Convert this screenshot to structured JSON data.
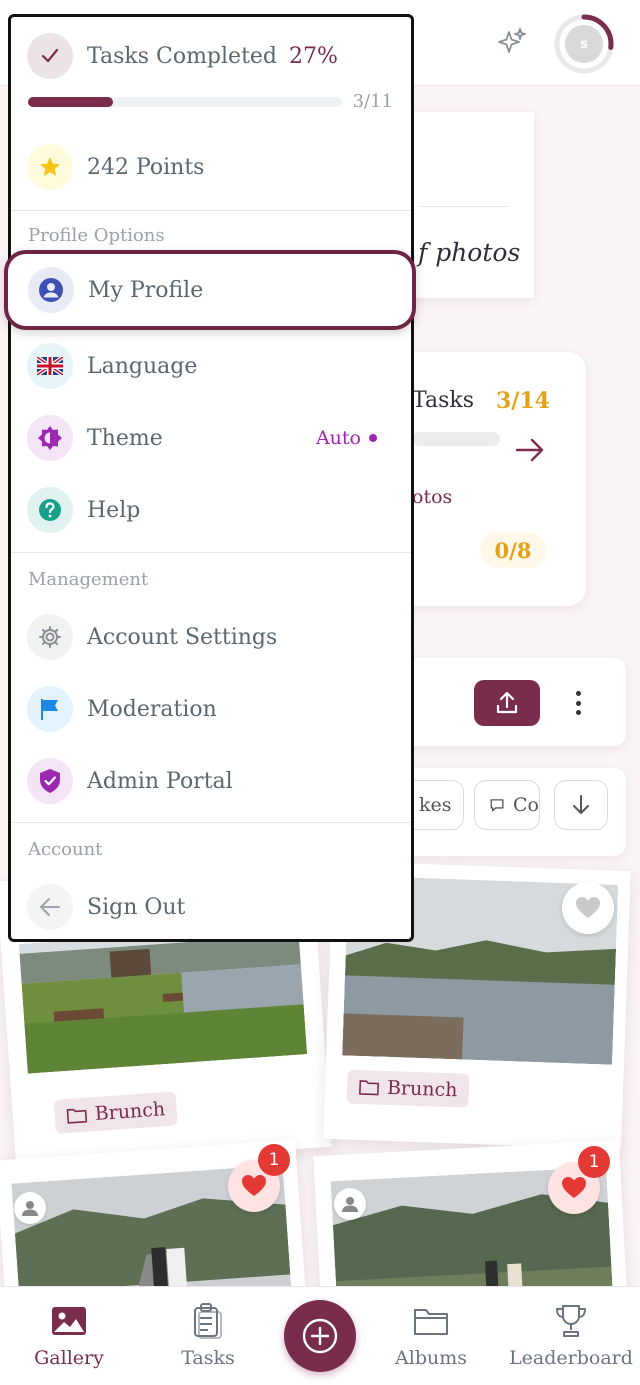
{
  "header": {
    "avatar_initial": "s",
    "icons": {
      "sparkle": "sparkle-icon"
    }
  },
  "colors": {
    "primary": "#7a2c4d",
    "gold": "#e3a21a",
    "purple": "#9c27b0",
    "danger": "#e53935"
  },
  "background": {
    "description_text": "f photos",
    "tasks_label": "Tasks",
    "tasks_count": "3/14",
    "photos_label": "otos",
    "photos_count": "0/8",
    "filters": {
      "likes": "kes",
      "comments": "Co"
    }
  },
  "menu": {
    "tasks_completed_label": "Tasks Completed",
    "tasks_completed_pct": "27%",
    "tasks_progress_fraction": 0.27,
    "tasks_count": "3/11",
    "points": "242 Points",
    "sections": {
      "profile": "Profile Options",
      "management": "Management",
      "account": "Account"
    },
    "items": {
      "my_profile": "My Profile",
      "language": "Language",
      "theme": "Theme",
      "theme_value": "Auto",
      "help": "Help",
      "account_settings": "Account Settings",
      "moderation": "Moderation",
      "admin_portal": "Admin Portal",
      "sign_out": "Sign Out"
    }
  },
  "gallery": {
    "photos": [
      {
        "album": "Brunch",
        "likes": ""
      },
      {
        "album": "Brunch",
        "likes": ""
      },
      {
        "album": "",
        "likes": "1"
      },
      {
        "album": "",
        "likes": "1"
      }
    ]
  },
  "nav": {
    "gallery": "Gallery",
    "tasks": "Tasks",
    "albums": "Albums",
    "leaderboard": "Leaderboard"
  }
}
